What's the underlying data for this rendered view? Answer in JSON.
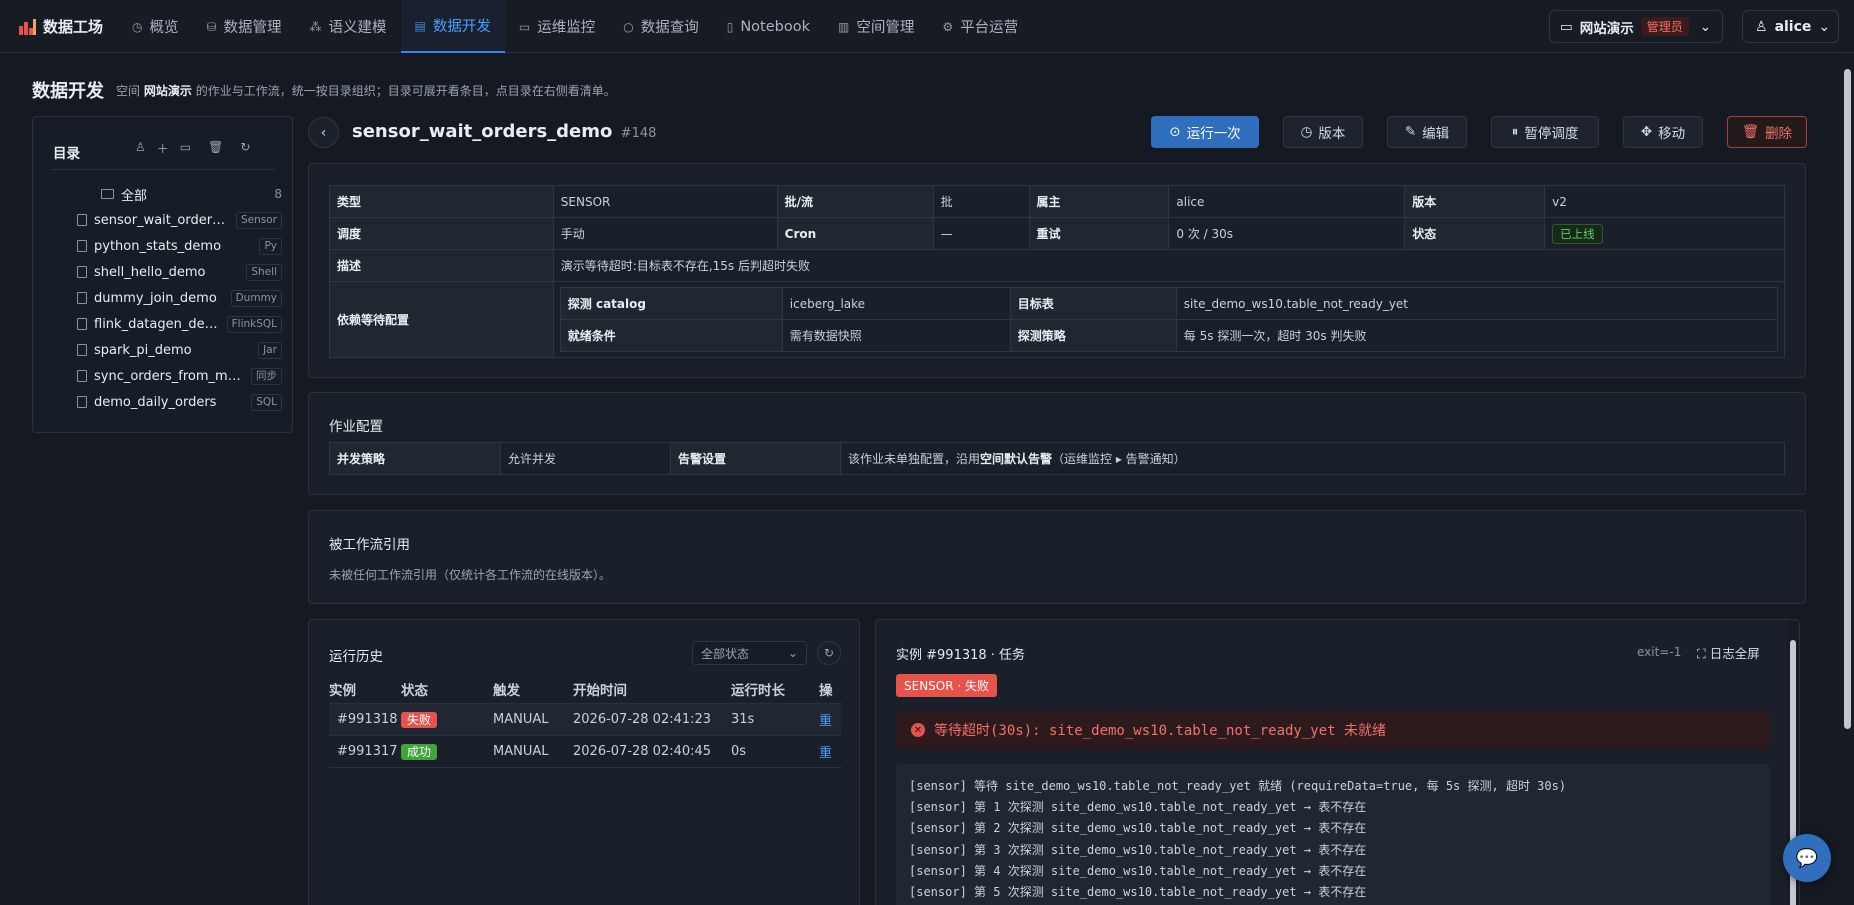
{
  "app": {
    "title": "数据工场"
  },
  "nav": {
    "items": [
      {
        "label": "概览",
        "icon": "dashboard-icon"
      },
      {
        "label": "数据管理",
        "icon": "database-icon"
      },
      {
        "label": "语义建模",
        "icon": "sparkle-icon"
      },
      {
        "label": "数据开发",
        "icon": "code-file-icon",
        "active": true
      },
      {
        "label": "运维监控",
        "icon": "monitor-icon"
      },
      {
        "label": "数据查询",
        "icon": "search-icon"
      },
      {
        "label": "Notebook",
        "icon": "notebook-icon"
      },
      {
        "label": "空间管理",
        "icon": "building-icon"
      },
      {
        "label": "平台运营",
        "icon": "gear-icon"
      }
    ]
  },
  "space": {
    "name": "网站演示",
    "role": "管理员"
  },
  "user": {
    "name": "alice"
  },
  "page": {
    "title": "数据开发",
    "desc_prefix": "空间",
    "desc_space": "网站演示",
    "desc_suffix": "的作业与工作流，统一按目录组织；目录可展开看条目，点目录在右侧看清单。"
  },
  "sidebar": {
    "title": "目录",
    "root": {
      "label": "全部",
      "count": "8"
    },
    "items": [
      {
        "label": "sensor_wait_orders_demo",
        "tag": "Sensor"
      },
      {
        "label": "python_stats_demo",
        "tag": "Py"
      },
      {
        "label": "shell_hello_demo",
        "tag": "Shell"
      },
      {
        "label": "dummy_join_demo",
        "tag": "Dummy"
      },
      {
        "label": "flink_datagen_demo",
        "tag": "FlinkSQL"
      },
      {
        "label": "spark_pi_demo",
        "tag": "Jar"
      },
      {
        "label": "sync_orders_from_mysql",
        "tag": "同步"
      },
      {
        "label": "demo_daily_orders",
        "tag": "SQL"
      }
    ]
  },
  "job": {
    "name": "sensor_wait_orders_demo",
    "id": "#148",
    "actions": {
      "run": "运行一次",
      "version": "版本",
      "edit": "编辑",
      "pause": "暂停调度",
      "move": "移动",
      "delete": "删除"
    },
    "info": {
      "type_k": "类型",
      "type_v": "SENSOR",
      "batch_k": "批/流",
      "batch_v": "批",
      "owner_k": "属主",
      "owner_v": "alice",
      "version_k": "版本",
      "version_v": "v2",
      "sched_k": "调度",
      "sched_v": "手动",
      "cron_k": "Cron",
      "cron_v": "—",
      "retry_k": "重试",
      "retry_v": "0 次 / 30s",
      "status_k": "状态",
      "status_v": "已上线",
      "desc_k": "描述",
      "desc_v": "演示等待超时:目标表不存在,15s 后判超时失败",
      "dep_k": "依赖等待配置",
      "probe_catalog_k": "探测 catalog",
      "probe_catalog_v": "iceberg_lake",
      "target_k": "目标表",
      "target_v": "site_demo_ws10.table_not_ready_yet",
      "ready_k": "就绪条件",
      "ready_v": "需有数据快照",
      "strategy_k": "探测策略",
      "strategy_v": "每 5s 探测一次，超时 30s 判失败"
    }
  },
  "job_config": {
    "title": "作业配置",
    "concurrency_k": "并发策略",
    "concurrency_v": "允许并发",
    "alert_k": "告警设置",
    "alert_v_prefix": "该作业未单独配置，沿用",
    "alert_v_bold": "空间默认告警",
    "alert_v_suffix": "（运维监控 ▸ 告警通知）"
  },
  "refs": {
    "title": "被工作流引用",
    "empty": "未被任何工作流引用（仅统计各工作流的在线版本）。"
  },
  "history": {
    "title": "运行历史",
    "filter": "全部状态",
    "columns": [
      "实例",
      "状态",
      "触发",
      "开始时间",
      "运行时长",
      "操"
    ],
    "rows": [
      {
        "id": "#991318",
        "status": "失败",
        "trigger": "MANUAL",
        "start": "2026-07-28 02:41:23",
        "duration": "31s",
        "op": "重"
      },
      {
        "id": "#991317",
        "status": "成功",
        "trigger": "MANUAL",
        "start": "2026-07-28 02:40:45",
        "duration": "0s",
        "op": "重"
      }
    ]
  },
  "instance": {
    "title": "实例 #991318 · 任务",
    "exit": "exit=-1",
    "fullscreen": "日志全屏",
    "badge": "SENSOR · 失败",
    "error": "等待超时(30s): site_demo_ws10.table_not_ready_yet 未就绪",
    "log": [
      "[sensor] 等待 site_demo_ws10.table_not_ready_yet 就绪 (requireData=true, 每 5s 探测, 超时 30s)",
      "[sensor] 第 1 次探测 site_demo_ws10.table_not_ready_yet → 表不存在",
      "[sensor] 第 2 次探测 site_demo_ws10.table_not_ready_yet → 表不存在",
      "[sensor] 第 3 次探测 site_demo_ws10.table_not_ready_yet → 表不存在",
      "[sensor] 第 4 次探测 site_demo_ws10.table_not_ready_yet → 表不存在",
      "[sensor] 第 5 次探测 site_demo_ws10.table_not_ready_yet → 表不存在"
    ]
  },
  "colors": {
    "accent": "#3b82f6",
    "danger": "#e5534b",
    "success": "#3fa43a",
    "bg": "#141922"
  }
}
